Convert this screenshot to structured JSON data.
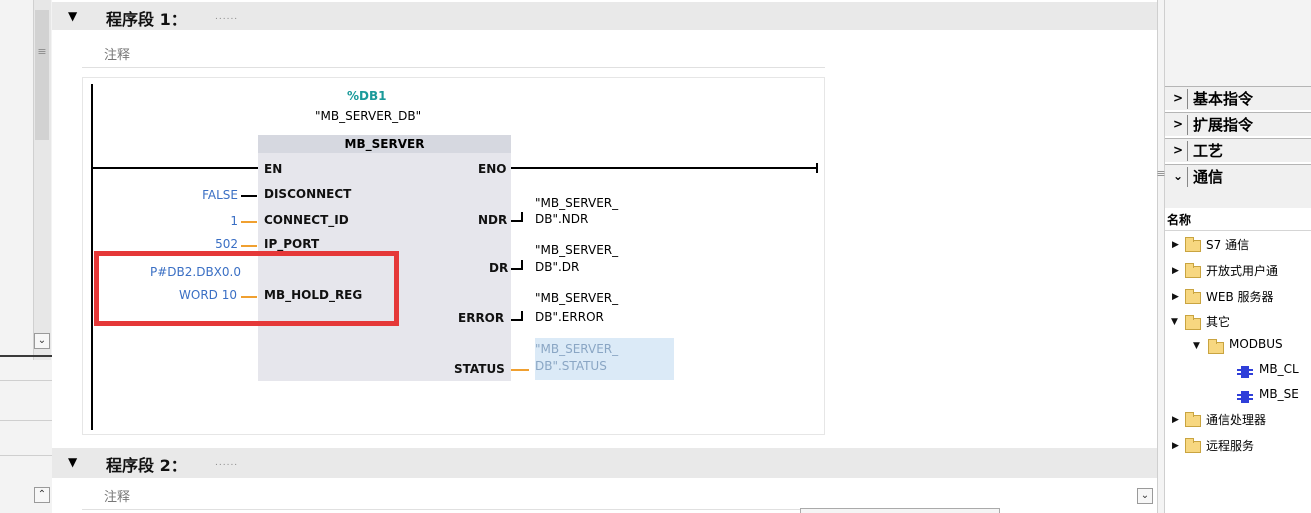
{
  "networks": [
    {
      "title": "程序段 1：",
      "dots": "......",
      "comment": "注释"
    },
    {
      "title": "程序段 2：",
      "dots": "......",
      "comment": "注释"
    }
  ],
  "block": {
    "db_name": "%DB1",
    "db_symbol": "\"MB_SERVER_DB\"",
    "type": "MB_SERVER",
    "inputs": [
      "EN",
      "DISCONNECT",
      "CONNECT_ID",
      "IP_PORT",
      "MB_HOLD_REG"
    ],
    "outputs": [
      "ENO",
      "NDR",
      "DR",
      "ERROR",
      "STATUS"
    ],
    "input_values": {
      "disconnect": "FALSE",
      "connect_id": "1",
      "ip_port": "502",
      "hold_reg_line1": "P#DB2.DBX0.0",
      "hold_reg_line2": "WORD 10"
    },
    "output_values": {
      "ndr_line1": "\"MB_SERVER_",
      "ndr_line2": "DB\".NDR",
      "dr_line1": "\"MB_SERVER_",
      "dr_line2": "DB\".DR",
      "error_line1": "\"MB_SERVER_",
      "error_line2": "DB\".ERROR",
      "status_line1": "\"MB_SERVER_",
      "status_line2": "DB\".STATUS"
    }
  },
  "categories": [
    {
      "label": "基本指令",
      "expanded": false
    },
    {
      "label": "扩展指令",
      "expanded": false
    },
    {
      "label": "工艺",
      "expanded": false
    },
    {
      "label": "通信",
      "expanded": true
    }
  ],
  "tree": {
    "header": "名称",
    "items": [
      "S7 通信",
      "开放式用户通",
      "WEB 服务器",
      "其它",
      "MODBUS",
      "MB_CL",
      "MB_SE",
      "通信处理器",
      "远程服务"
    ]
  },
  "colors": {
    "highlight": "#e53838",
    "value_blue": "#3a6fc4",
    "wire_orange": "#f0a030",
    "db_teal": "#1a9a9a"
  }
}
